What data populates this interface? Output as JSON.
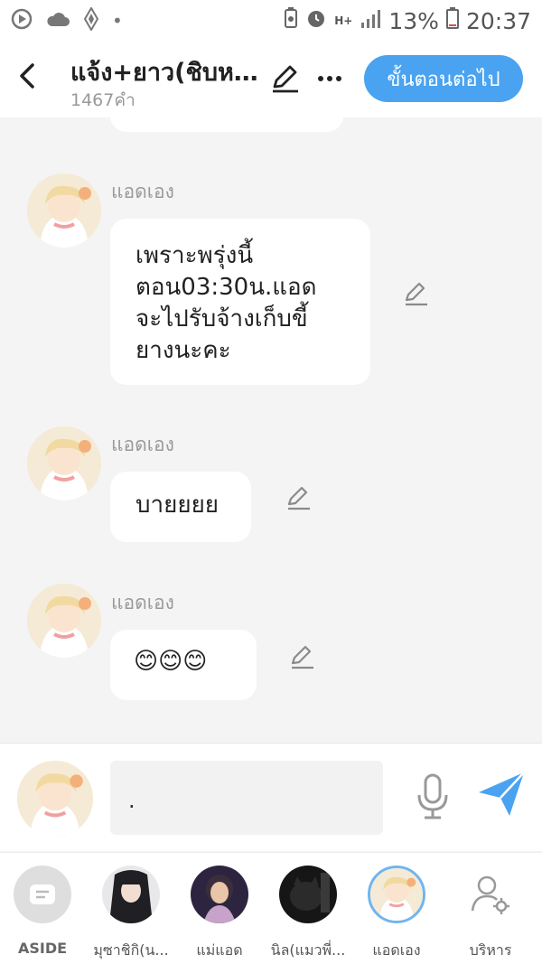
{
  "status_bar": {
    "battery": "13%",
    "time": "20:37",
    "network": "H+"
  },
  "header": {
    "title": "แจ้ง+ยาว(ชิบห...",
    "word_count": "1467คำ",
    "next_label": "ขั้นตอนต่อไป",
    "accent_color": "#4aa3f0"
  },
  "messages": [
    {
      "sender": "แอดเอง",
      "lines": [
        "เพราะพรุ่งนี้",
        "ตอน03:30น.แอด",
        "จะไปรับจ้างเก็บขี้",
        "ยางนะคะ"
      ]
    },
    {
      "sender": "แอดเอง",
      "lines": [
        "บายยยย"
      ]
    },
    {
      "sender": "แอดเอง",
      "lines": [
        "😊😊😊"
      ]
    }
  ],
  "composer": {
    "value": "."
  },
  "bottom_nav": [
    {
      "label": "ASIDE",
      "icon": "aside-icon"
    },
    {
      "label": "มุซาชิกิ(น..."
    },
    {
      "label": "แม่แอด"
    },
    {
      "label": "นิล(แมวพี่..."
    },
    {
      "label": "แอดเอง",
      "selected": true
    },
    {
      "label": "บริหาร",
      "icon": "manage-user-icon"
    }
  ]
}
